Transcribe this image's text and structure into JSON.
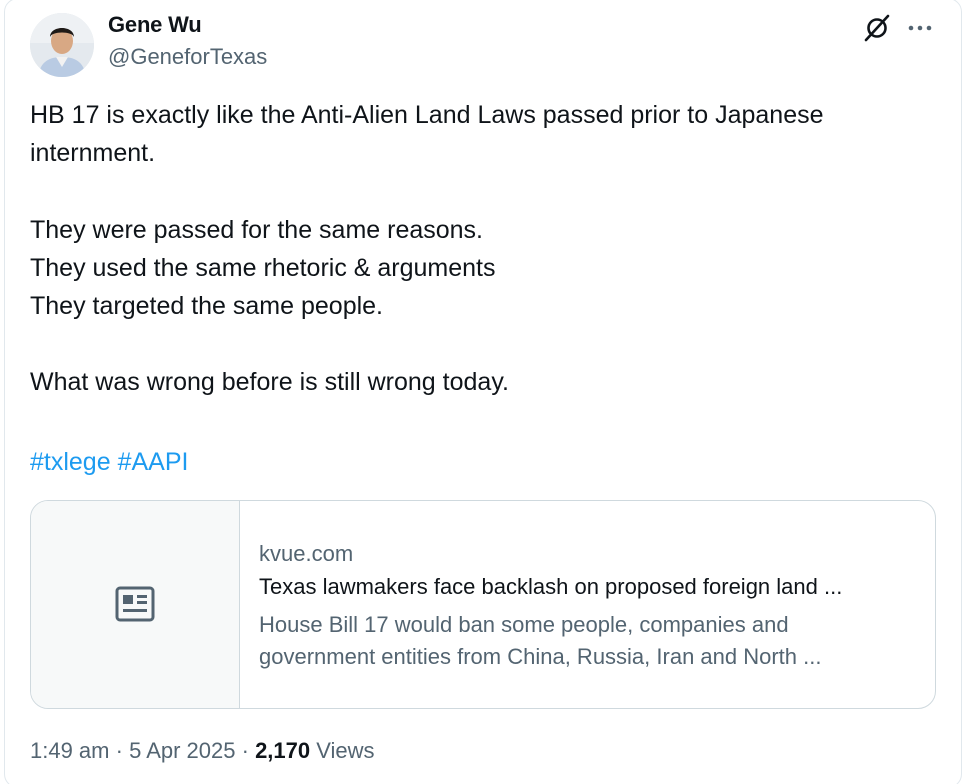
{
  "author": {
    "name": "Gene Wu",
    "handle": "@GeneforTexas"
  },
  "icons": {
    "avatar": "profile-photo",
    "grok": "grok-slash-icon",
    "more": "more-dots-icon",
    "article": "newspaper-icon"
  },
  "tweet": {
    "text": "HB 17 is exactly like the Anti-Alien Land Laws passed prior to Japanese\ninternment.\n\nThey were passed for the same reasons.\nThey used the same rhetoric & arguments\nThey targeted the same people.\n\nWhat was wrong before is still wrong today.",
    "hashtags": [
      "#txlege",
      "#AAPI"
    ]
  },
  "link_card": {
    "domain": "kvue.com",
    "title": "Texas lawmakers face backlash on proposed foreign land ...",
    "description_line1": "House Bill 17 would ban some people, companies and",
    "description_line2": "government entities from China, Russia, Iran and North ..."
  },
  "meta": {
    "time": "1:49 am",
    "separator": " · ",
    "date": "5 Apr 2025",
    "views_count": "2,170",
    "views_label": " Views"
  },
  "colors": {
    "accent": "#1d9bf0",
    "text": "#0f1419",
    "secondary": "#536471",
    "border": "#cfd9de"
  }
}
